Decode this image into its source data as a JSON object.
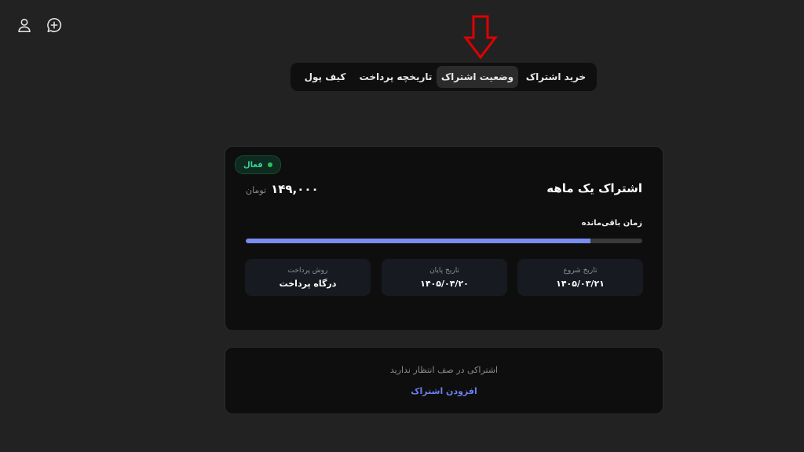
{
  "header": {
    "icons": [
      "user-icon",
      "chat-plus-icon"
    ]
  },
  "tabs": [
    {
      "label": "خرید اشتراک",
      "active": false
    },
    {
      "label": "وضعیت اشتراک",
      "active": true
    },
    {
      "label": "تاریخچه پرداخت",
      "active": false
    },
    {
      "label": "کیف پول",
      "active": false
    }
  ],
  "colors": {
    "background": "#222222",
    "card": "#0e0e0e",
    "accent": "#7b8cf0",
    "status_active": "#34d399",
    "arrow": "#e00000"
  },
  "subscription": {
    "status": "فعال",
    "plan_title": "اشتراک یک ماهه",
    "price": "۱۴۹,۰۰۰",
    "currency": "تومان",
    "remaining_label": "زمان باقی‌مانده",
    "remaining_fraction": 0.87,
    "start_label": "تاریخ شروع",
    "start_value": "۱۴۰۵/۰۳/۲۱",
    "end_label": "تاریخ پایان",
    "end_value": "۱۴۰۵/۰۴/۲۰",
    "method_label": "روش پرداخت",
    "method_value": "درگاه پرداخت"
  },
  "queue": {
    "message": "اشتراکی در صف انتظار ندارید",
    "add_link": "افزودن اشتراک"
  }
}
